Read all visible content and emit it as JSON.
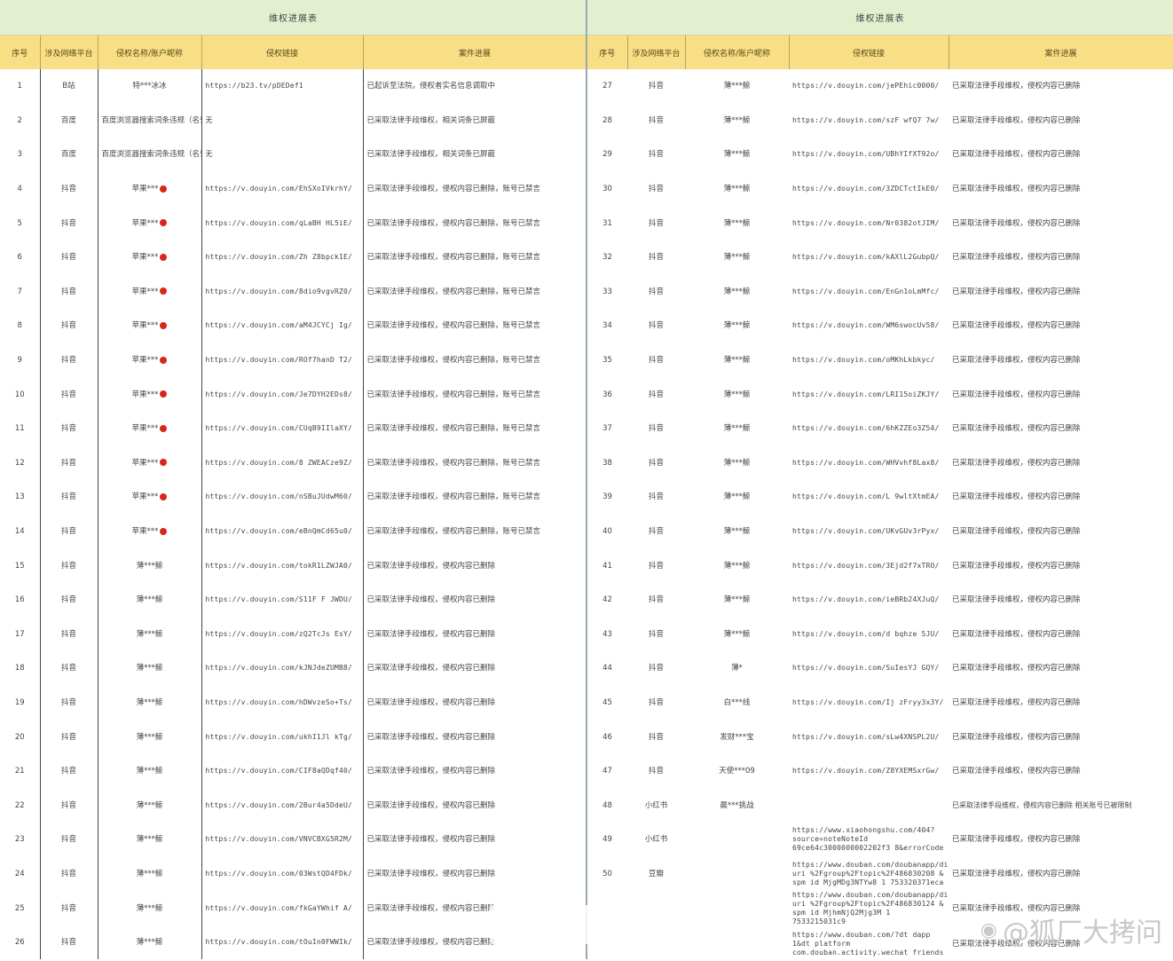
{
  "left_panel": {
    "title": "维权进展表",
    "headers": [
      "序号",
      "涉及网络平台",
      "侵权名称/账户昵称",
      "侵权链接",
      "案件进展"
    ],
    "rows": [
      {
        "no": "1",
        "platform": "B站",
        "name": "特***冰冰",
        "url": "https://b23.tv/pDEDef1",
        "progress": "已起诉至法院，侵权者实名信息调取中"
      },
      {
        "no": "2",
        "platform": "百度",
        "name": "百度浏览器搜索词条违规（名誉权侵权）",
        "url": "无",
        "progress": "已采取法律手段维权，相关词条已屏蔽"
      },
      {
        "no": "3",
        "platform": "百度",
        "name": "百度浏览器搜索词条违规（名誉权侵权）",
        "url": "无",
        "progress": "已采取法律手段维权，相关词条已屏蔽"
      },
      {
        "no": "4",
        "platform": "抖音",
        "name": "苹果***",
        "url": "https://v.douyin.com/EhSXoIVkrhY/",
        "progress": "已采取法律手段维权，侵权内容已删除，账号已禁言"
      },
      {
        "no": "5",
        "platform": "抖音",
        "name": "苹果***",
        "url": "https://v.douyin.com/qLaBH HL5iE/",
        "progress": "已采取法律手段维权，侵权内容已删除，账号已禁言"
      },
      {
        "no": "6",
        "platform": "抖音",
        "name": "苹果***",
        "url": "https://v.douyin.com/Zh Z8bpck1E/",
        "progress": "已采取法律手段维权，侵权内容已删除，账号已禁言"
      },
      {
        "no": "7",
        "platform": "抖音",
        "name": "苹果***",
        "url": "https://v.douyin.com/8dio9vgvRZ0/",
        "progress": "已采取法律手段维权，侵权内容已删除，账号已禁言"
      },
      {
        "no": "8",
        "platform": "抖音",
        "name": "苹果***",
        "url": "https://v.douyin.com/aM4JCYCj Ig/",
        "progress": "已采取法律手段维权，侵权内容已删除，账号已禁言"
      },
      {
        "no": "9",
        "platform": "抖音",
        "name": "苹果***",
        "url": "https://v.douyin.com/ROf7hanD T2/",
        "progress": "已采取法律手段维权，侵权内容已删除，账号已禁言"
      },
      {
        "no": "10",
        "platform": "抖音",
        "name": "苹果***",
        "url": "https://v.douyin.com/Je7DYH2EDs8/",
        "progress": "已采取法律手段维权，侵权内容已删除，账号已禁言"
      },
      {
        "no": "11",
        "platform": "抖音",
        "name": "苹果***",
        "url": "https://v.douyin.com/CUqB9IIlaXY/",
        "progress": "已采取法律手段维权，侵权内容已删除，账号已禁言"
      },
      {
        "no": "12",
        "platform": "抖音",
        "name": "苹果***",
        "url": "https://v.douyin.com/8 ZWEACze9Z/",
        "progress": "已采取法律手段维权，侵权内容已删除，账号已禁言"
      },
      {
        "no": "13",
        "platform": "抖音",
        "name": "苹果***",
        "url": "https://v.douyin.com/nSBuJUdwM60/",
        "progress": "已采取法律手段维权，侵权内容已删除，账号已禁言"
      },
      {
        "no": "14",
        "platform": "抖音",
        "name": "苹果***",
        "url": "https://v.douyin.com/eBnQmCd65u0/",
        "progress": "已采取法律手段维权，侵权内容已删除，账号已禁言"
      },
      {
        "no": "15",
        "platform": "抖音",
        "name": "薄***鲸",
        "url": "https://v.douyin.com/tokR1LZWJA0/",
        "progress": "已采取法律手段维权，侵权内容已删除"
      },
      {
        "no": "16",
        "platform": "抖音",
        "name": "薄***鲸",
        "url": "https://v.douyin.com/S11F F JWDU/",
        "progress": "已采取法律手段维权，侵权内容已删除"
      },
      {
        "no": "17",
        "platform": "抖音",
        "name": "薄***鲸",
        "url": "https://v.douyin.com/zQ2TcJs EsY/",
        "progress": "已采取法律手段维权，侵权内容已删除"
      },
      {
        "no": "18",
        "platform": "抖音",
        "name": "薄***鲸",
        "url": "https://v.douyin.com/kJNJdeZUMB8/",
        "progress": "已采取法律手段维权，侵权内容已删除"
      },
      {
        "no": "19",
        "platform": "抖音",
        "name": "薄***鲸",
        "url": "https://v.douyin.com/hDWvzeSo+Ts/",
        "progress": "已采取法律手段维权，侵权内容已删除"
      },
      {
        "no": "20",
        "platform": "抖音",
        "name": "薄***鲸",
        "url": "https://v.douyin.com/ukhI1Jl kTg/",
        "progress": "已采取法律手段维权，侵权内容已删除"
      },
      {
        "no": "21",
        "platform": "抖音",
        "name": "薄***鲸",
        "url": "https://v.douyin.com/CIF8aQDqf40/",
        "progress": "已采取法律手段维权，侵权内容已删除"
      },
      {
        "no": "22",
        "platform": "抖音",
        "name": "薄***鲸",
        "url": "https://v.douyin.com/2Bur4a5DdeU/",
        "progress": "已采取法律手段维权，侵权内容已删除"
      },
      {
        "no": "23",
        "platform": "抖音",
        "name": "薄***鲸",
        "url": "https://v.douyin.com/VNVCBXG5R2M/",
        "progress": "已采取法律手段维权，侵权内容已删除"
      },
      {
        "no": "24",
        "platform": "抖音",
        "name": "薄***鲸",
        "url": "https://v.douyin.com/03WstQD4FDk/",
        "progress": "已采取法律手段维权，侵权内容已删除"
      },
      {
        "no": "25",
        "platform": "抖音",
        "name": "薄***鲸",
        "url": "https://v.douyin.com/fkGaYWhif A/",
        "progress": "已采取法律手段维权，侵权内容已删除"
      },
      {
        "no": "26",
        "platform": "抖音",
        "name": "薄***鲸",
        "url": "https://v.douyin.com/tOuIn0FWWIk/",
        "progress": "已采取法律手段维权，侵权内容已删除"
      }
    ]
  },
  "right_panel": {
    "title": "维权进展表",
    "headers": [
      "序号",
      "涉及网络平台",
      "侵权名称/账户昵称",
      "侵权链接",
      "案件进展"
    ],
    "rows": [
      {
        "no": "27",
        "platform": "抖音",
        "name": "薄***鲸",
        "url": "https://v.douyin.com/jePEhic0000/",
        "progress": "已采取法律手段维权，侵权内容已删除"
      },
      {
        "no": "28",
        "platform": "抖音",
        "name": "薄***鲸",
        "url": "https://v.douyin.com/szF wfQ7 7w/",
        "progress": "已采取法律手段维权，侵权内容已删除"
      },
      {
        "no": "29",
        "platform": "抖音",
        "name": "薄***鲸",
        "url": "https://v.douyin.com/UBhYIfXT92o/",
        "progress": "已采取法律手段维权，侵权内容已删除"
      },
      {
        "no": "30",
        "platform": "抖音",
        "name": "薄***鲸",
        "url": "https://v.douyin.com/3ZDCTctIkE0/",
        "progress": "已采取法律手段维权，侵权内容已删除"
      },
      {
        "no": "31",
        "platform": "抖音",
        "name": "薄***鲸",
        "url": "https://v.douyin.com/Nr0382otJIM/",
        "progress": "已采取法律手段维权，侵权内容已删除"
      },
      {
        "no": "32",
        "platform": "抖音",
        "name": "薄***鲸",
        "url": "https://v.douyin.com/kAXlL2GubpQ/",
        "progress": "已采取法律手段维权，侵权内容已删除"
      },
      {
        "no": "33",
        "platform": "抖音",
        "name": "薄***鲸",
        "url": "https://v.douyin.com/EnGn1oLmMfc/",
        "progress": "已采取法律手段维权，侵权内容已删除"
      },
      {
        "no": "34",
        "platform": "抖音",
        "name": "薄***鲸",
        "url": "https://v.douyin.com/WM6swocUv58/",
        "progress": "已采取法律手段维权，侵权内容已删除"
      },
      {
        "no": "35",
        "platform": "抖音",
        "name": "薄***鲸",
        "url": "https://v.douyin.com/oMKhLkbkyc/",
        "progress": "已采取法律手段维权，侵权内容已删除"
      },
      {
        "no": "36",
        "platform": "抖音",
        "name": "薄***鲸",
        "url": "https://v.douyin.com/LRI15oiZKJY/",
        "progress": "已采取法律手段维权，侵权内容已删除"
      },
      {
        "no": "37",
        "platform": "抖音",
        "name": "薄***鲸",
        "url": "https://v.douyin.com/6hKZZEo3Z54/",
        "progress": "已采取法律手段维权，侵权内容已删除"
      },
      {
        "no": "38",
        "platform": "抖音",
        "name": "薄***鲸",
        "url": "https://v.douyin.com/WHVvhf8Lax8/",
        "progress": "已采取法律手段维权，侵权内容已删除"
      },
      {
        "no": "39",
        "platform": "抖音",
        "name": "薄***鲸",
        "url": "https://v.douyin.com/L 9wltXtmEA/",
        "progress": "已采取法律手段维权，侵权内容已删除"
      },
      {
        "no": "40",
        "platform": "抖音",
        "name": "薄***鲸",
        "url": "https://v.douyin.com/UKvGUv3rPyx/",
        "progress": "已采取法律手段维权，侵权内容已删除"
      },
      {
        "no": "41",
        "platform": "抖音",
        "name": "薄***鲸",
        "url": "https://v.douyin.com/3Ejd2f7xTRO/",
        "progress": "已采取法律手段维权，侵权内容已删除"
      },
      {
        "no": "42",
        "platform": "抖音",
        "name": "薄***鲸",
        "url": "https://v.douyin.com/ieBRb24XJuQ/",
        "progress": "已采取法律手段维权，侵权内容已删除"
      },
      {
        "no": "43",
        "platform": "抖音",
        "name": "薄***鲸",
        "url": "https://v.douyin.com/d bqhze 5JU/",
        "progress": "已采取法律手段维权，侵权内容已删除"
      },
      {
        "no": "44",
        "platform": "抖音",
        "name": "薄*",
        "url": "https://v.douyin.com/SuIesYJ GQY/",
        "progress": "已采取法律手段维权，侵权内容已删除"
      },
      {
        "no": "45",
        "platform": "抖音",
        "name": "白***线",
        "url": "https://v.douyin.com/Ij zFryy3x3Y/",
        "progress": "已采取法律手段维权，侵权内容已删除"
      },
      {
        "no": "46",
        "platform": "抖音",
        "name": "发财***宝",
        "url": "https://v.douyin.com/sLw4XNSPL2U/",
        "progress": "已采取法律手段维权，侵权内容已删除"
      },
      {
        "no": "47",
        "platform": "抖音",
        "name": "天使***09",
        "url": "https://v.douyin.com/Z8YXEMSxrGw/",
        "progress": "已采取法律手段维权，侵权内容已删除"
      },
      {
        "no": "48",
        "platform": "小红书",
        "name": "晨***挑战",
        "url": "",
        "progress": "已采取法律手段维权，侵权内容已删除 相关账号已被限制"
      },
      {
        "no": "49",
        "platform": "小红书",
        "name": "",
        "url": "https://www.xiaohongshu.com/404?source=noteNoteId 69ce64c3000000002202f3 8&errorCode",
        "progress": "已采取法律手段维权，侵权内容已删除"
      },
      {
        "no": "50",
        "platform": "豆瓣",
        "name": "",
        "url": "https://www.douban.com/doubanapp/dispatch?uri %2Fgroup%2Ftopic%2F486830208 & spm id MjgMDg3NTYw8 1 753320371eca",
        "progress": "已采取法律手段维权，侵权内容已删除"
      },
      {
        "no": "",
        "platform": "",
        "name": "",
        "url": "https://www.douban.com/doubanapp/dispatch?uri %2Fgroup%2Ftopic%2F486830124 & spm id MjhmNjQ2Mjg3M 1 7533215031c9",
        "progress": "已采取法律手段维权，侵权内容已删除"
      },
      {
        "no": "",
        "platform": "",
        "name": "",
        "url": "https://www.douban.com/?dt dapp 1&dt platform com.douban.activity.wechat friends",
        "progress": "已采取法律手段维权，侵权内容已删除"
      }
    ]
  },
  "watermark": "@狐厂大拷问",
  "colors": {
    "header_green": "#e3f0d0",
    "header_yellow": "#f8df86",
    "name_dot": "#d9261c"
  }
}
